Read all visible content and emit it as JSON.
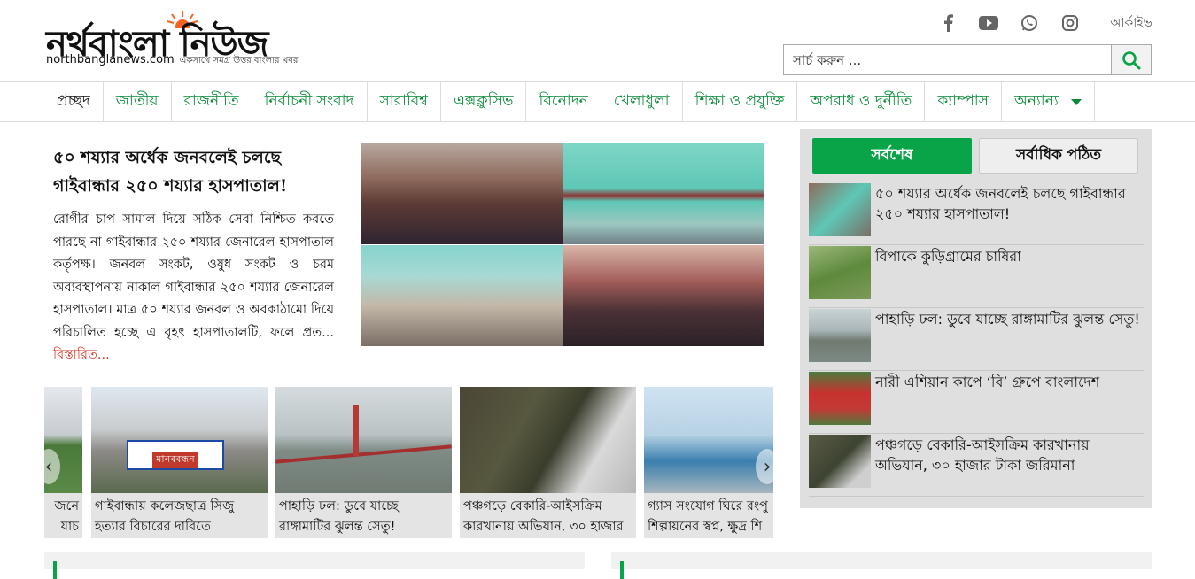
{
  "site": {
    "logo_text": "নর্থবাংলা নিউজ",
    "logo_url": "northbanglanews.com",
    "logo_tagline": "একসাথে সমগ্র উত্তর বাংলার খবর",
    "brand_color": "#0aa448",
    "accent_color": "#d2331f"
  },
  "header": {
    "archive_label": "আর্কাইভ",
    "social_icons": [
      "facebook-icon",
      "youtube-icon",
      "whatsapp-icon",
      "instagram-icon"
    ],
    "search_placeholder": "সার্চ করুন ..."
  },
  "nav": {
    "items": [
      "প্রচ্ছদ",
      "জাতীয়",
      "রাজনীতি",
      "নির্বাচনী সংবাদ",
      "সারাবিশ্ব",
      "এক্সক্লুসিভ",
      "বিনোদন",
      "খেলাধুলা",
      "শিক্ষা ও প্রযুক্তি",
      "অপরাধ ও দুর্নীতি",
      "ক্যাম্পাস",
      "অন্যান্য"
    ]
  },
  "lead": {
    "title": "৫০ শয্যার অর্ধেক জনবলেই চলছে গাইবান্ধার ২৫০ শয্যার হাসপাতাল!",
    "summary": "রোগীর চাপ সামাল দিয়ে সঠিক সেবা নিশ্চিত করতে পারছে না গাইবান্ধার ২৫০ শয্যার জেনারেল হাসপাতাল কর্তৃপক্ষ। জনবল সংকট, ওষুধ সংকট ও চরম অব্যবস্থাপনায় নাকাল গাইবান্ধার ২৫০ শয্যার জেনারেল হাসপাতাল। মাত্র ৫০ শয্যার জনবল ও অবকাঠামো দিয়ে পরিচালিত হচ্ছে এ বৃহৎ হাসপাতালটি, ফলে প্রত...",
    "read_more": "বিস্তারিত..."
  },
  "sidebar": {
    "tab_latest": "সর্বশেষ",
    "tab_most_read": "সর্বাধিক পঠিত",
    "items": [
      {
        "title": "৫০ শয্যার অর্ধেক জনবলেই চলছে গাইবান্ধার ২৫০ শয্যার হাসপাতাল!"
      },
      {
        "title": "বিপাকে কুড়িগ্রামের চাষিরা"
      },
      {
        "title": "পাহাড়ি ঢল: ডুবে যাচ্ছে রাঙ্গামাটির ঝুলন্ত সেতু!"
      },
      {
        "title": "নারী এশিয়ান কাপে ‘বি’ গ্রুপে বাংলাদেশ"
      },
      {
        "title": "পঞ্চগড়ে বেকারি-আইসক্রিম কারখানায় অভিযান, ৩০ হাজার টাকা জরিমানা"
      }
    ]
  },
  "carousel": {
    "prev_label": "‹",
    "next_label": "›",
    "cards": [
      {
        "line1": "জনে",
        "line2": "যাচ"
      },
      {
        "line1": "গাইবান্ধায় কলেজছাত্র সিজু",
        "line2": "হত্যার বিচারের দাবিতে",
        "banner": "মানববন্ধন"
      },
      {
        "line1": "পাহাড়ি ঢল: ডুবে যাচ্ছে",
        "line2": "রাঙ্গামাটির ঝুলন্ত সেতু!"
      },
      {
        "line1": "পঞ্চগড়ে বেকারি-আইসক্রিম",
        "line2": "কারখানায় অভিযান, ৩০ হাজার"
      },
      {
        "line1": "গ্যাস সংযোগ ঘিরে রংপু",
        "line2": "শিল্পায়নের স্বপ্ন, ক্ষুদ্র শি"
      }
    ]
  }
}
